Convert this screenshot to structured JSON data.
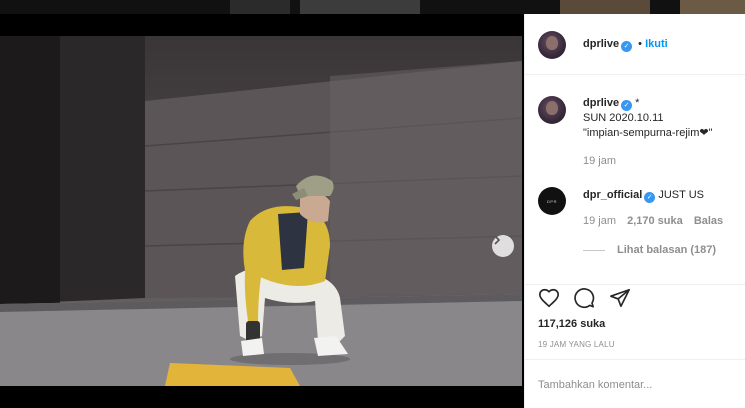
{
  "post": {
    "author": "dprlive",
    "follow_separator": "•",
    "follow_label": "Ikuti",
    "caption_user": "dprlive",
    "caption_star": "*",
    "caption_line1": "SUN 2020.10.11",
    "caption_line2": "\"impian-sempurna-rejim❤\"",
    "caption_time": "19 jam",
    "avatar_icon": "profile-photo",
    "next_icon": "chevron-right-icon"
  },
  "comment": {
    "user": "dpr_official",
    "avatar_text": "DPR",
    "text": "JUST US",
    "time": "19 jam",
    "likes": "2,170 suka",
    "reply_label": "Balas",
    "view_replies": "Lihat balasan (187)"
  },
  "actions": {
    "like_icon": "heart-outline-icon",
    "comment_icon": "speech-bubble-icon",
    "share_icon": "paper-plane-icon",
    "likes_count": "117,126 suka",
    "timestamp": "19 JAM YANG LALU"
  },
  "add_comment": {
    "placeholder": "Tambahkan komentar..."
  },
  "carousel": {
    "total": 2,
    "current": 1
  },
  "colors": {
    "accent": "#0095f6",
    "verified": "#3897f0",
    "text": "#262626",
    "muted": "#8e8e8e"
  }
}
